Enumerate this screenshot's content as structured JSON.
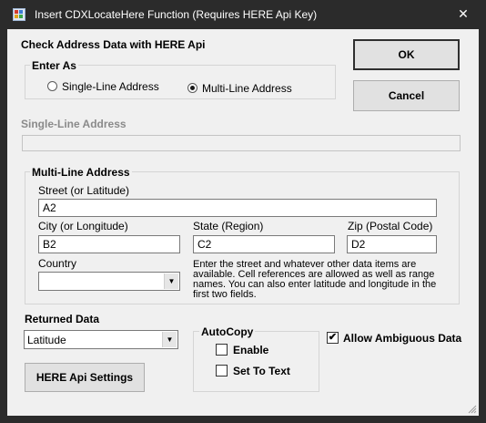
{
  "window": {
    "title": "Insert CDXLocateHere Function (Requires HERE Api Key)",
    "close_glyph": "✕"
  },
  "header": {
    "heading": "Check Address Data with HERE Api"
  },
  "buttons": {
    "ok": "OK",
    "cancel": "Cancel",
    "settings": "HERE Api Settings"
  },
  "enter_as": {
    "label": "Enter As",
    "options": [
      {
        "label": "Single-Line Address",
        "selected": false
      },
      {
        "label": "Multi-Line Address",
        "selected": true
      }
    ]
  },
  "single_line": {
    "label": "Single-Line Address",
    "value": ""
  },
  "multi_line": {
    "label": "Multi-Line Address",
    "street_label": "Street (or Latitude)",
    "street_value": "A2",
    "city_label": "City (or Longitude)",
    "city_value": "B2",
    "state_label": "State (Region)",
    "state_value": "C2",
    "zip_label": "Zip (Postal Code)",
    "zip_value": "D2",
    "country_label": "Country",
    "country_value": "",
    "help_lines": [
      "Enter the street and whatever other data items are",
      "available. Cell references are allowed as well as range",
      "names.  You can also enter latitude and longitude in the",
      "first two fields."
    ]
  },
  "returned_data": {
    "label": "Returned Data",
    "value": "Latitude"
  },
  "autocopy": {
    "label": "AutoCopy",
    "enable_label": "Enable",
    "enable_checked": false,
    "set_to_text_label": "Set To Text",
    "set_to_text_checked": false
  },
  "allow_ambiguous": {
    "label": "Allow Ambiguous Data",
    "checked": true
  },
  "icons": {
    "dropdown": "chevron-down-icon",
    "check": "✔"
  },
  "colors": {
    "titlebar": "#2b2b2b",
    "client": "#f0f0f0"
  }
}
